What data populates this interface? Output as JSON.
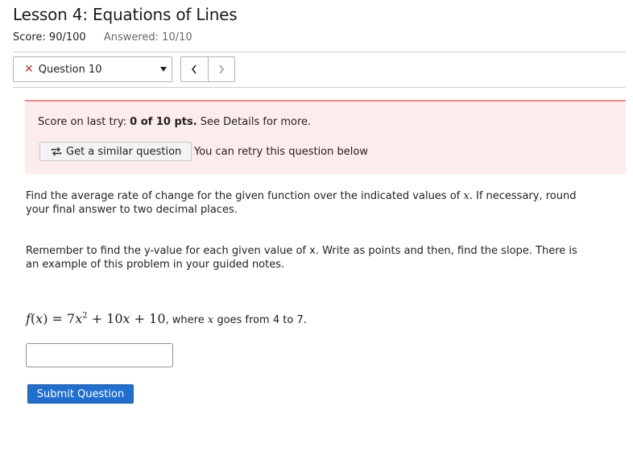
{
  "header": {
    "title": "Lesson 4: Equations of Lines",
    "score": "Score: 90/100",
    "answered": "Answered: 10/10"
  },
  "nav": {
    "question_label": "Question 10",
    "status_mark": "✕",
    "prev_icon": "chevron-left-icon",
    "next_icon": "chevron-right-icon"
  },
  "feedback": {
    "prefix": "Score on last try: ",
    "score": "0 of 10 pts.",
    "suffix": " See Details for more.",
    "similar_button": "Get a similar question",
    "retry_text": "You can retry this question below"
  },
  "question": {
    "p1_before": "Find the average rate of change for the given function over the indicated values of ",
    "p1_var": "x",
    "p1_after": ". If necessary, round your final answer to two decimal places.",
    "p2": "Remember to find the y-value for each given value of x. Write as points and then, find the slope. There is an example of this problem in your guided notes.",
    "formula_fx": "f(x)",
    "formula_eq": " = ",
    "formula_body": "7x² + 10x + 10",
    "formula_where": ", where ",
    "formula_var": "x",
    "formula_range": " goes from 4 to 7."
  },
  "answer": {
    "value": "",
    "placeholder": ""
  },
  "submit_label": "Submit Question",
  "colors": {
    "accent": "#1f6fd1",
    "error": "#c0392b",
    "feedback_bg": "#fdecec",
    "feedback_border": "#f08b8b"
  }
}
